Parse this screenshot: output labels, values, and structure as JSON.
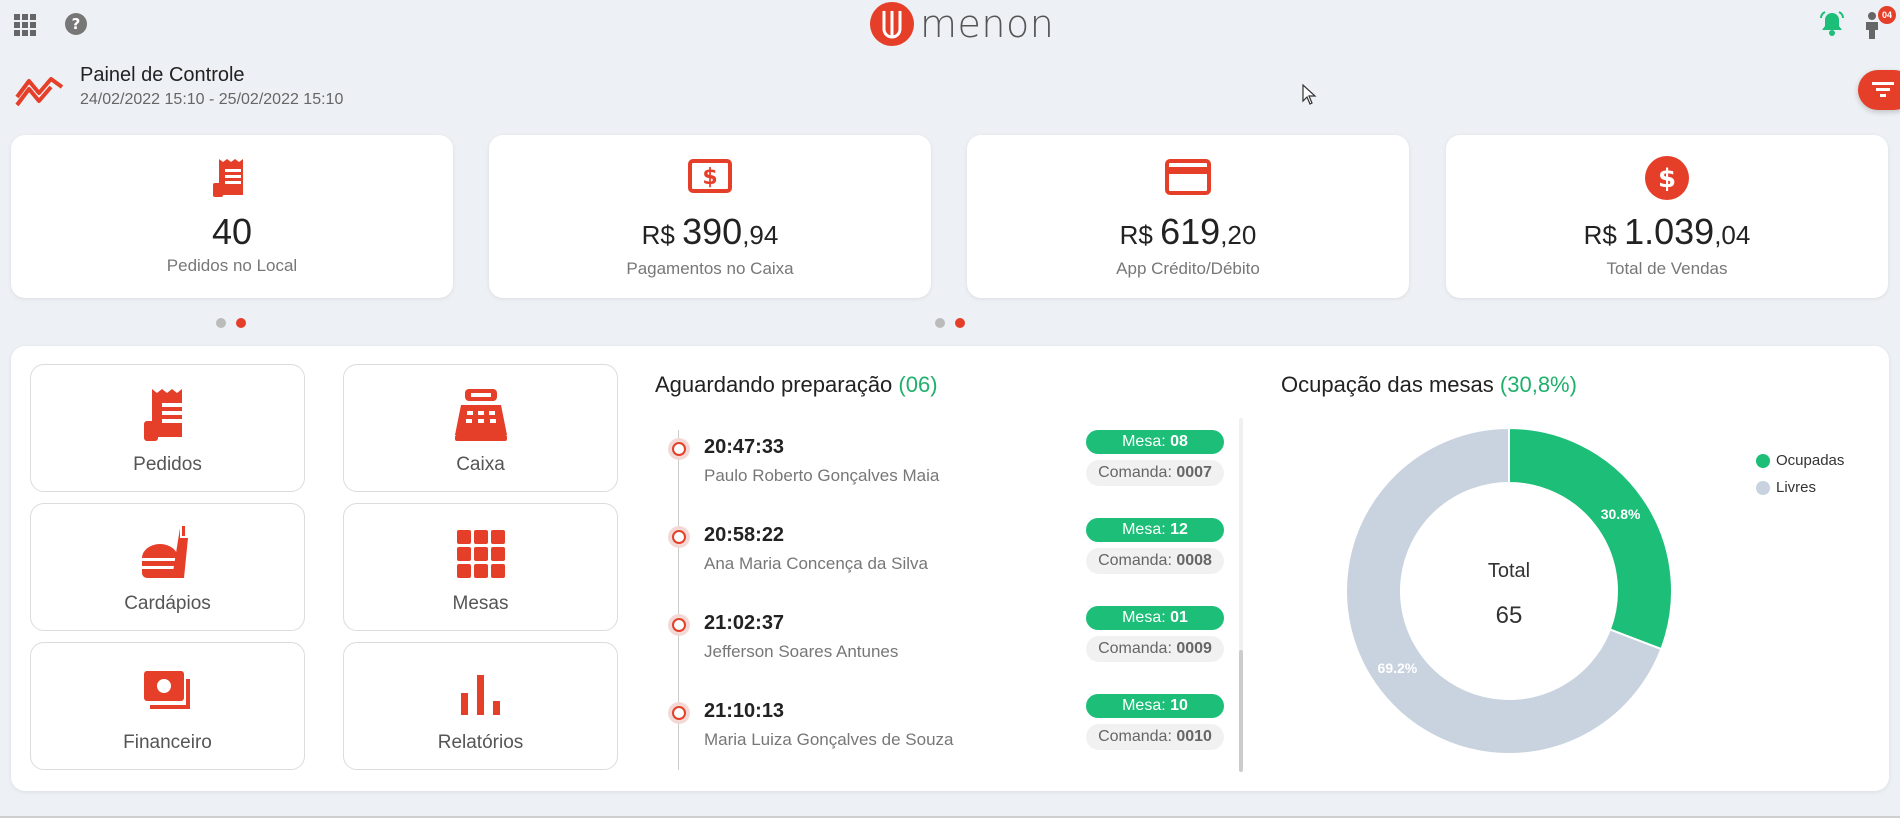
{
  "header": {
    "logo_text": "menon",
    "notification_badge": "04"
  },
  "page": {
    "title": "Painel de Controle",
    "date_range": "24/02/2022 15:10 - 25/02/2022 15:10"
  },
  "stats": [
    {
      "icon": "receipt-icon",
      "value": "40",
      "label": "Pedidos no Local"
    },
    {
      "icon": "cash-register-icon",
      "currency": "R$ ",
      "value": "390",
      "decimals": ",94",
      "label": "Pagamentos no Caixa"
    },
    {
      "icon": "credit-card-icon",
      "currency": "R$ ",
      "value": "619",
      "decimals": ",20",
      "label": "App Crédito/Débito"
    },
    {
      "icon": "dollar-coin-icon",
      "currency": "R$ ",
      "value": "1.039",
      "decimals": ",04",
      "label": "Total de Vendas"
    }
  ],
  "tiles": [
    {
      "label": "Pedidos",
      "icon": "receipt-icon"
    },
    {
      "label": "Caixa",
      "icon": "cash-register-icon"
    },
    {
      "label": "Cardápios",
      "icon": "food-menu-icon"
    },
    {
      "label": "Mesas",
      "icon": "tables-grid-icon"
    },
    {
      "label": "Financeiro",
      "icon": "money-icon"
    },
    {
      "label": "Relatórios",
      "icon": "bar-chart-icon"
    }
  ],
  "waiting": {
    "title": "Aguardando preparação",
    "count": "(06)",
    "orders": [
      {
        "time": "20:47:33",
        "name": "Paulo Roberto Gonçalves Maia",
        "mesa_label": "Mesa: ",
        "mesa": "08",
        "comanda_label": "Comanda: ",
        "comanda": "0007"
      },
      {
        "time": "20:58:22",
        "name": "Ana Maria Concença da Silva",
        "mesa_label": "Mesa: ",
        "mesa": "12",
        "comanda_label": "Comanda: ",
        "comanda": "0008"
      },
      {
        "time": "21:02:37",
        "name": "Jefferson Soares Antunes",
        "mesa_label": "Mesa: ",
        "mesa": "01",
        "comanda_label": "Comanda: ",
        "comanda": "0009"
      },
      {
        "time": "21:10:13",
        "name": "Maria Luiza Gonçalves de Souza",
        "mesa_label": "Mesa: ",
        "mesa": "10",
        "comanda_label": "Comanda: ",
        "comanda": "0010"
      }
    ]
  },
  "occupancy": {
    "title": "Ocupação das mesas",
    "percent": "(30,8%)",
    "total_label": "Total",
    "total_value": "65"
  },
  "chart_data": {
    "type": "pie",
    "categories": [
      "Ocupadas",
      "Livres"
    ],
    "values": [
      30.8,
      69.2
    ],
    "data_labels": [
      "30.8%",
      "69.2%"
    ],
    "colors": [
      "#1cbe78",
      "#c8d3df"
    ],
    "legend_position": "top-right"
  },
  "colors": {
    "accent": "#e53f2a",
    "green": "#1cbe78"
  }
}
